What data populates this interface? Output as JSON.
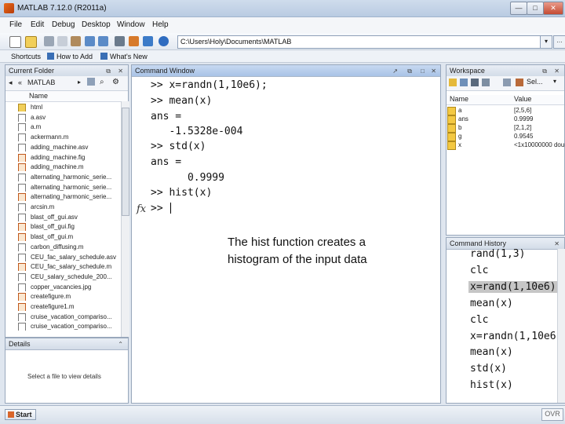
{
  "window": {
    "title": "MATLAB 7.12.0 (R2011a)",
    "minimize": "—",
    "maximize": "□",
    "close": "✕"
  },
  "menu": [
    "File",
    "Edit",
    "Debug",
    "Desktop",
    "Window",
    "Help"
  ],
  "toolbar": {
    "path": "C:\\Users\\Holy\\Documents\\MATLAB",
    "dropdown": "▾",
    "browse": "…"
  },
  "shortcuts": {
    "label": "Shortcuts",
    "how_to_add": "How to Add",
    "whats_new": "What's New"
  },
  "current_folder": {
    "title": "Current Folder",
    "nav_folder": "MATLAB",
    "col_name": "Name",
    "files": [
      {
        "name": "html",
        "type": "folder"
      },
      {
        "name": "a.asv",
        "type": "file"
      },
      {
        "name": "a.m",
        "type": "file"
      },
      {
        "name": "ackermann.m",
        "type": "file"
      },
      {
        "name": "adding_machine.asv",
        "type": "file"
      },
      {
        "name": "adding_machine.fig",
        "type": "fig"
      },
      {
        "name": "adding_machine.m",
        "type": "fig"
      },
      {
        "name": "alternating_harmonic_serie...",
        "type": "file"
      },
      {
        "name": "alternating_harmonic_serie...",
        "type": "file"
      },
      {
        "name": "alternating_harmonic_serie...",
        "type": "fig"
      },
      {
        "name": "arcsin.m",
        "type": "file"
      },
      {
        "name": "blast_off_gui.asv",
        "type": "file"
      },
      {
        "name": "blast_off_gui.fig",
        "type": "fig"
      },
      {
        "name": "blast_off_gui.m",
        "type": "fig"
      },
      {
        "name": "carbon_diffusing.m",
        "type": "file"
      },
      {
        "name": "CEU_fac_salary_schedule.asv",
        "type": "file"
      },
      {
        "name": "CEU_fac_salary_schedule.m",
        "type": "fig"
      },
      {
        "name": "CEU_salary_schedule_200...",
        "type": "file"
      },
      {
        "name": "copper_vacancies.jpg",
        "type": "file"
      },
      {
        "name": "createfigure.m",
        "type": "fig"
      },
      {
        "name": "createfigure1.m",
        "type": "fig"
      },
      {
        "name": "cruise_vacation_compariso...",
        "type": "file"
      },
      {
        "name": "cruise_vacation_compariso...",
        "type": "file"
      }
    ]
  },
  "details": {
    "title": "Details",
    "hint": "Select a file to view details"
  },
  "command_window": {
    "title": "Command Window",
    "lines": [
      ">> x=randn(1,10e6);",
      ">> mean(x)",
      "ans =",
      "   -1.5328e-004",
      ">> std(x)",
      "ans =",
      "      0.9999",
      ">> hist(x)"
    ],
    "prompt": ">> ",
    "fx": "fx",
    "annotation_line1": "The hist function creates a",
    "annotation_line2": "histogram of the input data"
  },
  "workspace": {
    "title": "Workspace",
    "select_label": "Sel...",
    "col_name": "Name",
    "col_value": "Value",
    "vars": [
      {
        "name": "a",
        "value": "[2,5,6]"
      },
      {
        "name": "ans",
        "value": "0.9999"
      },
      {
        "name": "b",
        "value": "[2,1,2]"
      },
      {
        "name": "g",
        "value": "0.9545"
      },
      {
        "name": "x",
        "value": "<1x10000000 dou..."
      }
    ]
  },
  "command_history": {
    "title": "Command History",
    "entries": [
      "rand(1,3)",
      "clc",
      "x=rand(1,10e6)",
      "mean(x)",
      "clc",
      "x=randn(1,10e6",
      "mean(x)",
      "std(x)",
      "hist(x)"
    ],
    "selected_index": 2
  },
  "status": {
    "start": "Start",
    "ovr": "OVR"
  }
}
